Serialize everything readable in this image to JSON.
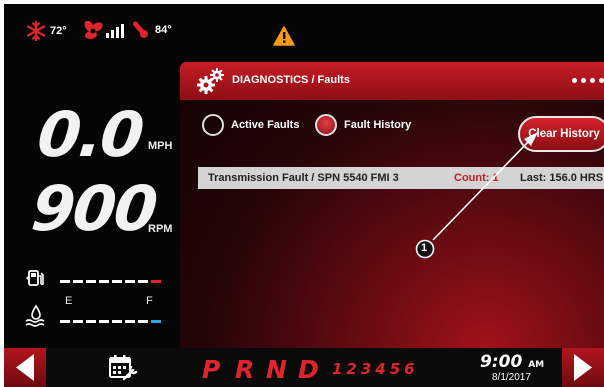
{
  "status_bar": {
    "coolant_temp": "72°",
    "outside_temp": "84°",
    "icons": [
      "snowflake-icon",
      "fan-icon",
      "signal-bars-icon",
      "thermometer-icon",
      "warning-icon"
    ]
  },
  "gauges": {
    "speed_value": "0.0",
    "speed_unit": "MPH",
    "rpm_value": "900",
    "rpm_unit": "RPM",
    "fuel_empty_label": "E",
    "fuel_full_label": "F"
  },
  "panel": {
    "title": "DIAGNOSTICS / Faults",
    "radio_active": "Active Faults",
    "radio_history": "Fault History",
    "selected": "Fault History",
    "clear_button": "Clear History",
    "faults": [
      {
        "name": "Transmission Fault / SPN 5540 FMI 3",
        "count": "Count: 1",
        "last": "Last: 156.0 HRS"
      }
    ],
    "callout": "1"
  },
  "bottom_bar": {
    "gears": [
      "P",
      "R",
      "N",
      "D"
    ],
    "gear_numbers": "123456",
    "time": "9:00",
    "ampm": "AM",
    "date": "8/1/2017"
  },
  "colors": {
    "accent_red": "#e0242b",
    "panel_red": "#c71b24",
    "fuel_bar": "#ffffff",
    "def_bar": "#2aa7e0"
  }
}
